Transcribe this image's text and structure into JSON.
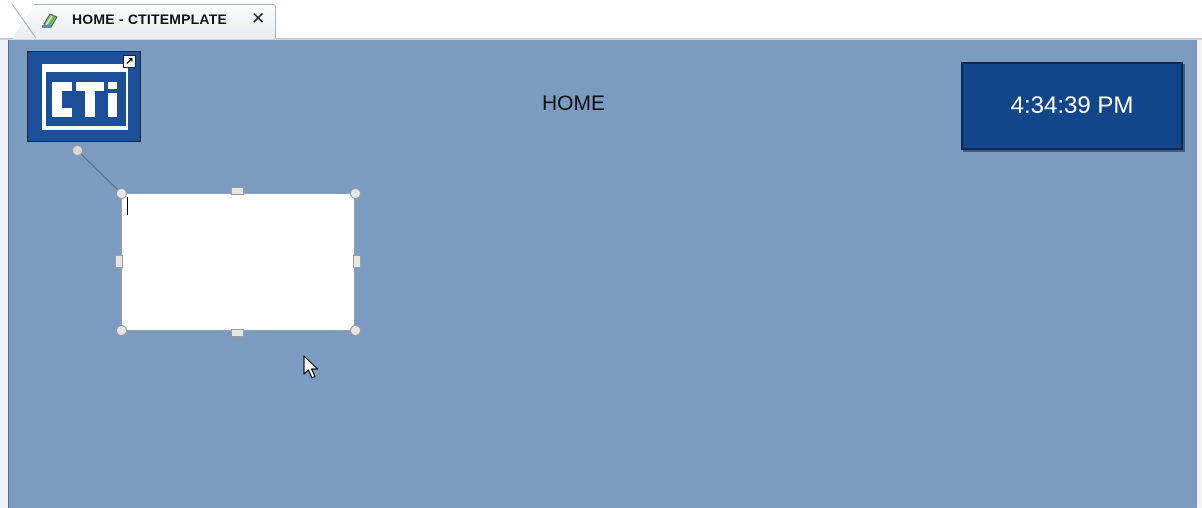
{
  "tab": {
    "title": "HOME - CTITEMPLATE",
    "close_glyph": "✕",
    "icon": "screen-document-icon"
  },
  "screen": {
    "title": "HOME",
    "background_color": "#7b9bc1"
  },
  "logo": {
    "text": "CTi",
    "icon": "cti-logo-icon",
    "shortcut_glyph": "↗"
  },
  "clock": {
    "time": "4:34:39 PM",
    "background_color": "#12468a"
  },
  "text_object": {
    "value": "",
    "selected": true
  }
}
